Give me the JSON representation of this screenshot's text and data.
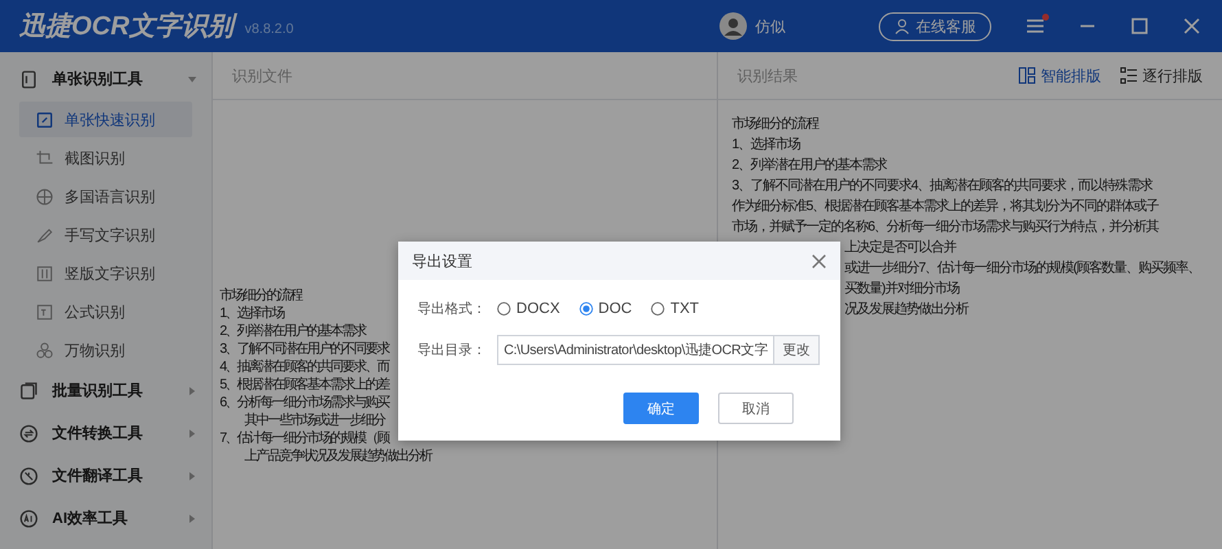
{
  "app": {
    "title": "迅捷OCR文字识别",
    "version": "v8.8.2.0"
  },
  "user": {
    "name": "仿似"
  },
  "service_button": {
    "label": "在线客服"
  },
  "menu": {
    "notification": true
  },
  "sidebar": {
    "groups": [
      {
        "label": "单张识别工具",
        "expanded": true,
        "items": [
          {
            "label": "单张快速识别",
            "selected": true
          },
          {
            "label": "截图识别",
            "selected": false
          },
          {
            "label": "多国语言识别",
            "selected": false
          },
          {
            "label": "手写文字识别",
            "selected": false
          },
          {
            "label": "竖版文字识别",
            "selected": false
          },
          {
            "label": "公式识别",
            "selected": false
          },
          {
            "label": "万物识别",
            "selected": false
          }
        ]
      },
      {
        "label": "批量识别工具",
        "expanded": false
      },
      {
        "label": "文件转换工具",
        "expanded": false
      },
      {
        "label": "文件翻译工具",
        "expanded": false
      },
      {
        "label": "AI效率工具",
        "expanded": false
      }
    ]
  },
  "source_panel": {
    "title": "识别文件",
    "document_lines": [
      {
        "text": "市场细分的流程",
        "continuation": false
      },
      {
        "text": "1、选择市场",
        "continuation": false
      },
      {
        "text": "2、列举潜在用户的基本需求",
        "continuation": false
      },
      {
        "text": "3、了解不同潜在用户的不同要求",
        "continuation": false
      },
      {
        "text": "4、抽离潜在顾客的共同要求、而",
        "continuation": false
      },
      {
        "text": "5、根据潜在顾客基本需求上的差",
        "continuation": false
      },
      {
        "text": "6、分析每一细分市场需求与购买",
        "continuation": false
      },
      {
        "text": "其中一些市场或进一步细分",
        "continuation": true
      },
      {
        "text": "7、估计每一细分市场的规模（顾",
        "continuation": false
      },
      {
        "text": "上产品竞争状况及发展趋势做出分析",
        "continuation": true
      }
    ]
  },
  "result_panel": {
    "title": "识别结果",
    "layout_options": [
      {
        "label": "智能排版",
        "selected": true
      },
      {
        "label": "逐行排版",
        "selected": false
      }
    ],
    "lines": [
      "市场细分的流程",
      "1、选择市场",
      "2、列举潜在用户的基本需求",
      "3、了解不同潜在用户的不同要求4、抽离潜在顾客的共同要求，而以特殊需求",
      "作为细分标准5、根据潜在顾客基本需求上的差异，将其划分为不同的群体或子",
      "市场，并赋予一定的名称6、分析每一细分市场需求与购买行为特点，并分析其"
    ],
    "line_ends_beside_dialog": [
      "上决定是否可以合并",
      "或进一步细分7、估计每一细分市场的规模(顾客数量、购买频率、",
      "买数量)并对细分市场",
      "况及发展趋势做出分析"
    ]
  },
  "dialog": {
    "title": "导出设置",
    "format_label": "导出格式：",
    "formats": [
      {
        "label": "DOCX",
        "selected": false
      },
      {
        "label": "DOC",
        "selected": true
      },
      {
        "label": "TXT",
        "selected": false
      }
    ],
    "directory_label": "导出目录：",
    "directory_value": "C:\\Users\\Administrator\\desktop\\迅捷OCR文字",
    "change_button": "更改",
    "buttons": [
      {
        "label": "确定",
        "kind": "primary"
      },
      {
        "label": "取消",
        "kind": "secondary"
      }
    ]
  }
}
